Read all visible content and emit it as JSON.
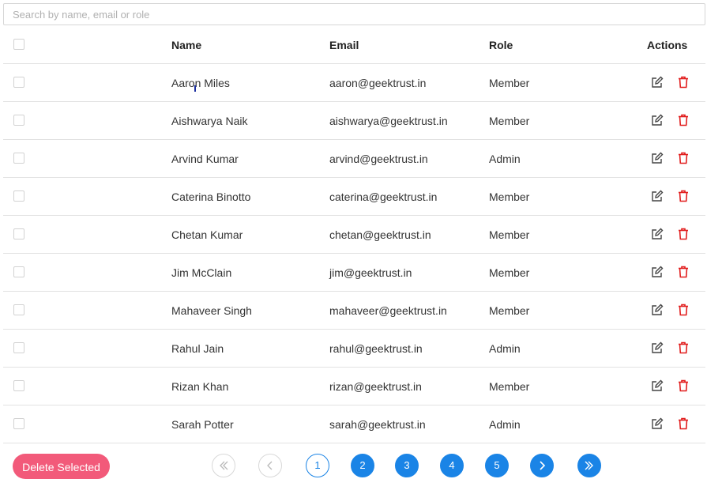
{
  "search": {
    "placeholder": "Search by name, email or role",
    "value": ""
  },
  "table": {
    "headers": {
      "name": "Name",
      "email": "Email",
      "role": "Role",
      "actions": "Actions"
    },
    "rows": [
      {
        "name": "Aaron Miles",
        "email": "aaron@geektrust.in",
        "role": "Member"
      },
      {
        "name": "Aishwarya Naik",
        "email": "aishwarya@geektrust.in",
        "role": "Member"
      },
      {
        "name": "Arvind Kumar",
        "email": "arvind@geektrust.in",
        "role": "Admin"
      },
      {
        "name": "Caterina Binotto",
        "email": "caterina@geektrust.in",
        "role": "Member"
      },
      {
        "name": "Chetan Kumar",
        "email": "chetan@geektrust.in",
        "role": "Member"
      },
      {
        "name": "Jim McClain",
        "email": "jim@geektrust.in",
        "role": "Member"
      },
      {
        "name": "Mahaveer Singh",
        "email": "mahaveer@geektrust.in",
        "role": "Member"
      },
      {
        "name": "Rahul Jain",
        "email": "rahul@geektrust.in",
        "role": "Admin"
      },
      {
        "name": "Rizan Khan",
        "email": "rizan@geektrust.in",
        "role": "Member"
      },
      {
        "name": "Sarah Potter",
        "email": "sarah@geektrust.in",
        "role": "Admin"
      }
    ]
  },
  "footer": {
    "delete_selected_label": "Delete Selected"
  },
  "pagination": {
    "first_label": "«",
    "prev_label": "‹",
    "pages": [
      "1",
      "2",
      "3",
      "4",
      "5"
    ],
    "current_page": "1",
    "next_label": "›",
    "last_label": "»"
  },
  "icons": {
    "edit": "edit-icon",
    "delete": "trash-icon"
  },
  "colors": {
    "accent": "#1a84e6",
    "danger": "#e11d1d",
    "delete_button": "#f25a7a",
    "border": "#e2e2e2"
  }
}
